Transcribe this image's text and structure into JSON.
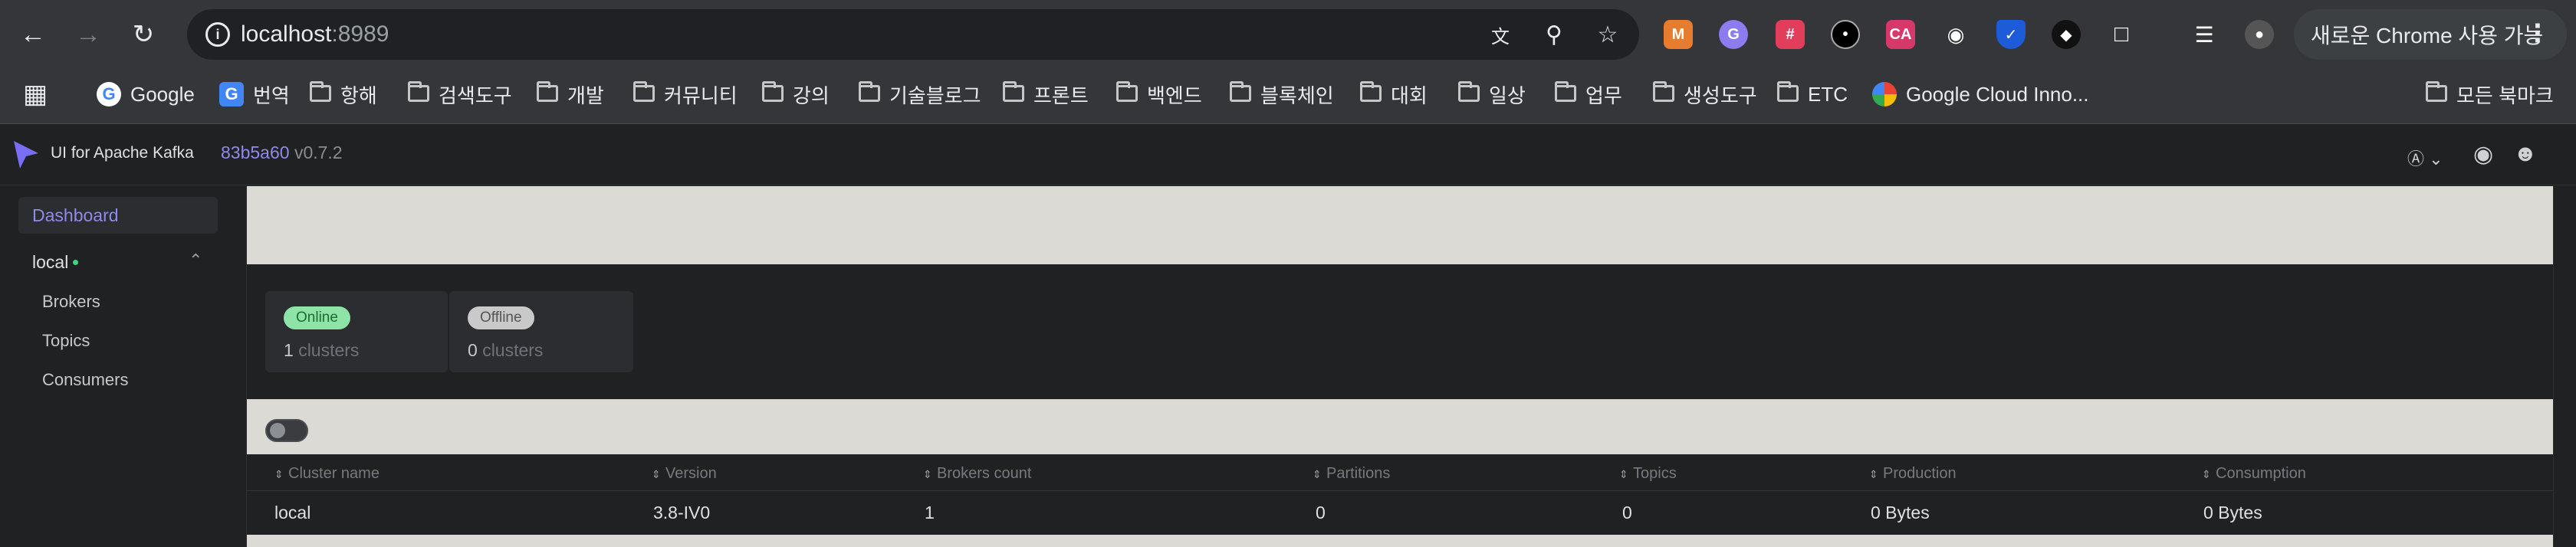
{
  "browser": {
    "url_host": "localhost",
    "url_port": ":8989",
    "update_button": "새로운 Chrome 사용 가능",
    "bookmarks": [
      {
        "label": "Google",
        "type": "google"
      },
      {
        "label": "번역",
        "type": "translate"
      },
      {
        "label": "항해",
        "type": "folder"
      },
      {
        "label": "검색도구",
        "type": "folder"
      },
      {
        "label": "개발",
        "type": "folder"
      },
      {
        "label": "커뮤니티",
        "type": "folder"
      },
      {
        "label": "강의",
        "type": "folder"
      },
      {
        "label": "기술블로그",
        "type": "folder"
      },
      {
        "label": "프론트",
        "type": "folder"
      },
      {
        "label": "백엔드",
        "type": "folder"
      },
      {
        "label": "블록체인",
        "type": "folder"
      },
      {
        "label": "대회",
        "type": "folder"
      },
      {
        "label": "일상",
        "type": "folder"
      },
      {
        "label": "업무",
        "type": "folder"
      },
      {
        "label": "생성도구",
        "type": "folder"
      },
      {
        "label": "ETC",
        "type": "folder"
      },
      {
        "label": "Google Cloud Inno...",
        "type": "gcloud"
      }
    ],
    "all_bookmarks": "모든 북마크"
  },
  "app": {
    "title": "UI for Apache Kafka",
    "commit": "83b5a60",
    "version": "v0.7.2"
  },
  "sidebar": {
    "dashboard": "Dashboard",
    "cluster": "local",
    "items": [
      "Brokers",
      "Topics",
      "Consumers"
    ]
  },
  "stats": {
    "online_label": "Online",
    "online_count": "1",
    "offline_label": "Offline",
    "offline_count": "0",
    "clusters_word": "clusters"
  },
  "table": {
    "columns": [
      "Cluster name",
      "Version",
      "Brokers count",
      "Partitions",
      "Topics",
      "Production",
      "Consumption"
    ],
    "rows": [
      [
        "local",
        "3.8-IV0",
        "1",
        "0",
        "0",
        "0 Bytes",
        "0 Bytes"
      ]
    ]
  },
  "colors": {
    "accent": "#8f8aeb",
    "online_bg": "#8de4a6",
    "online_text": "#1f6b35",
    "offline_bg": "#c9c9c9",
    "offline_text": "#555555",
    "band": "#dcdad5"
  }
}
